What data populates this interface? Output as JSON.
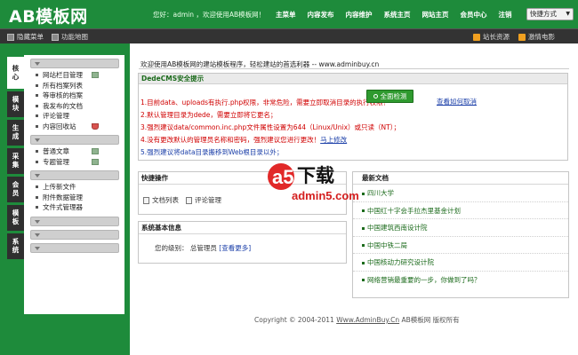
{
  "header": {
    "logo": "AB模板网",
    "greeting": "您好：admin ，欢迎使用AB模板网！",
    "nav": [
      "主菜单",
      "内容发布",
      "内容维护",
      "系统主页",
      "网站主页",
      "会员中心",
      "注销"
    ],
    "quick_menu": "快捷方式"
  },
  "subbar": {
    "hide_menu": "隐藏菜单",
    "function_map": "功能地图",
    "site_resources": "站长资源",
    "weekly_movie": "激情电影"
  },
  "vertical_tabs": [
    "核心",
    "模块",
    "生成",
    "采集",
    "会员",
    "模板",
    "系统"
  ],
  "menu": {
    "groups": [
      {
        "items": [
          "网站栏目管理",
          "所有档案列表",
          "等审核的档案",
          "我发布的文档",
          "评论管理",
          "内容回收站"
        ]
      },
      {
        "items": [
          "普通文章",
          "专题管理"
        ]
      },
      {
        "items": [
          "上传新文件",
          "附件数据管理",
          "文件式管理器"
        ]
      }
    ]
  },
  "main": {
    "welcome": "欢迎使用AB模板网的建站模板程序，轻松建站的首选利器 -- www.adminbuy.cn",
    "security": {
      "title": "DedeCMS安全提示",
      "lines": [
        "1.目前data、uploads有执行.php权限，非常危险，需要立即取消目录的执行权限！",
        "2.默认管理目录为dede，需要立即将它更名；",
        "3.强烈建议data/common.inc.php文件属性设置为644（Linux/Unix）或只读（NT）；",
        "4.没有更改默认的管理员名称和密码，强烈建议您进行更改！",
        "5.强烈建议将data目录搬移到Web根目录以外；"
      ],
      "line4_link": "马上修改",
      "scan_button": "全面检测",
      "howto_link": "查看如何取消"
    },
    "quick_ops": {
      "title": "快捷操作",
      "links": [
        "文档列表",
        "评论管理"
      ]
    },
    "system_info": {
      "title": "系统基本信息",
      "label": "您的级别：",
      "value": "总管理员",
      "more": "[查看更多]"
    },
    "newest": {
      "title": "最新文档",
      "items": [
        "四川大学",
        "中国红十字会手拉杰里基金计划",
        "中国建筑西南设计院",
        "中国中铁二局",
        "中国核动力研究设计院",
        "网络营销最重要的一步，你做到了吗？"
      ]
    },
    "footer_prefix": "Copyright © 2004-2011 ",
    "footer_link": "Www.AdminBuy.Cn",
    "footer_suffix": " AB模板网 版权所有"
  },
  "watermark": {
    "big": "a5",
    "chars": "下载",
    "url": "admin5.com"
  },
  "colors": {
    "brand_green": "#1e8b3b",
    "warning_red": "#d00000",
    "link_blue": "#1a3ea8"
  }
}
